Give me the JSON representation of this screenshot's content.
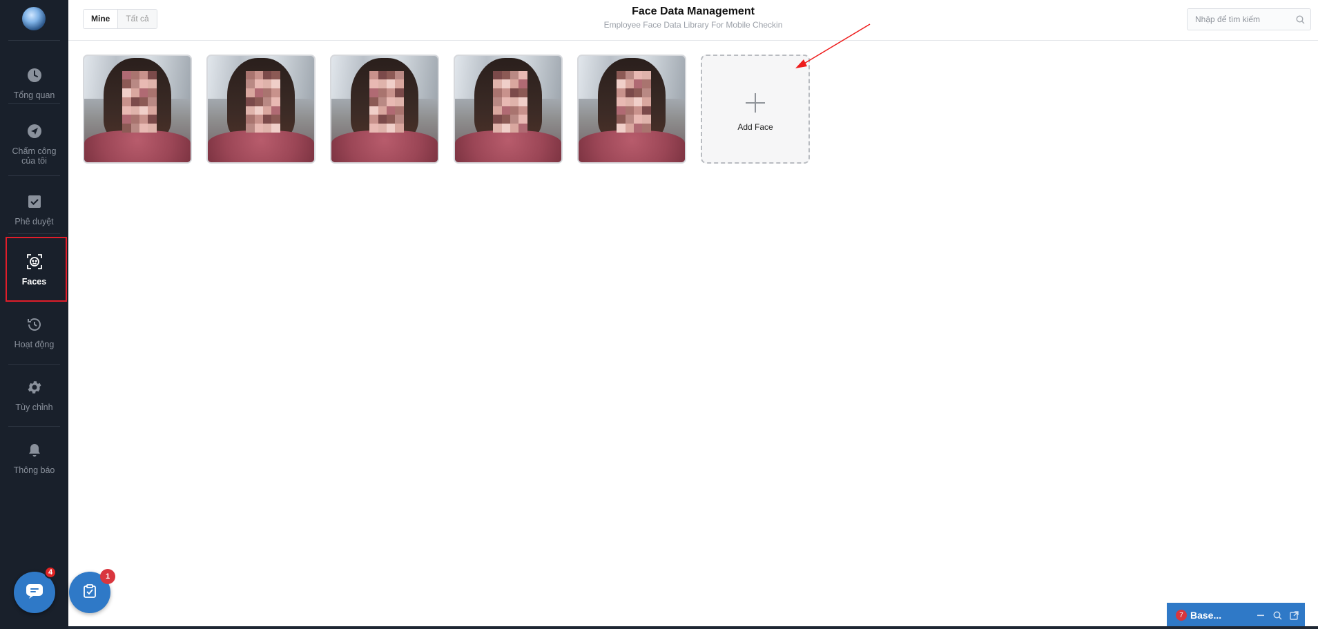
{
  "sidebar": {
    "items": [
      {
        "label": "Tổng quan",
        "icon": "clock-icon"
      },
      {
        "label": "Chấm công của tôi",
        "icon": "send-icon"
      },
      {
        "label": "Phê duyệt",
        "icon": "checkbox-icon"
      },
      {
        "label": "Faces",
        "icon": "face-scan-icon",
        "active": true
      },
      {
        "label": "Hoạt động",
        "icon": "history-icon"
      },
      {
        "label": "Tùy chỉnh",
        "icon": "gear-icon"
      },
      {
        "label": "Thông báo",
        "icon": "bell-icon"
      }
    ],
    "chat_badge": "4"
  },
  "header": {
    "filter_tabs": [
      {
        "label": "Mine",
        "active": true
      },
      {
        "label": "Tất cả",
        "active": false
      }
    ],
    "title": "Face Data Management",
    "subtitle": "Employee Face Data Library For Mobile Checkin",
    "search_placeholder": "Nhập để tìm kiếm"
  },
  "faces": {
    "count": 5,
    "add_label": "Add Face"
  },
  "task_badge": "1",
  "dock": {
    "badge": "7",
    "name": "Base..."
  },
  "colors": {
    "sidebar_bg": "#19202b",
    "accent": "#2f79c7",
    "highlight": "#e11d2a",
    "badge": "#d9363e"
  }
}
